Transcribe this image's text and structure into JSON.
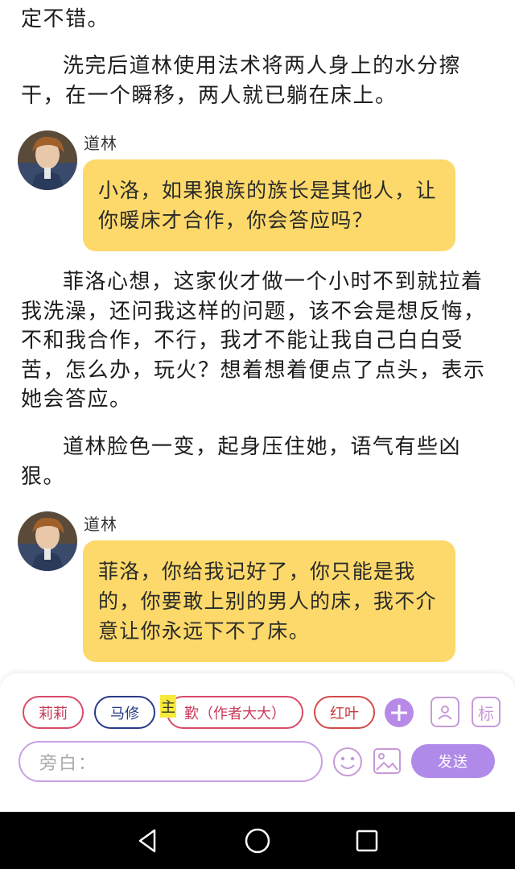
{
  "story": {
    "p1": "定不错。",
    "p2": "洗完后道林使用法术将两人身上的水分擦干，在一个瞬移，两人就已躺在床上。",
    "p3": "菲洛心想，这家伙才做一个小时不到就拉着我洗澡，还问我这样的问题，该不会是想反悔，不和我合作，不行，我才不能让我自己白白受苦，怎么办，玩火？想着想着便点了点头，表示她会答应。",
    "p4": "道林脸色一变，起身压住她，语气有些凶狠。"
  },
  "messages": [
    {
      "speaker": "道林",
      "text": "小洛，如果狼族的族长是其他人，让你暖床才合作，你会答应吗？"
    },
    {
      "speaker": "道林",
      "text": "菲洛，你给我记好了，你只能是我的，你要敢上别的男人的床，我不介意让你永远下不了床。"
    }
  ],
  "composer": {
    "characters": [
      "莉莉",
      "马修",
      "歏（作者大大）",
      "红叶"
    ],
    "main_tag": "主",
    "mark_label": "标",
    "input_placeholder": "旁白：",
    "send_label": "发送"
  },
  "icons": {
    "avatar": "character-avatar",
    "add": "plus-icon",
    "contact": "contact-card-icon",
    "mark": "mark-icon",
    "emoji": "smiley-icon",
    "image": "image-icon",
    "nav_back": "triangle-back-icon",
    "nav_home": "circle-home-icon",
    "nav_recent": "square-recent-icon"
  },
  "colors": {
    "bubble": "#fcd96a",
    "accent": "#b08ae8",
    "chip_pink": "#d94a6a",
    "chip_navy": "#2a3a8a"
  }
}
